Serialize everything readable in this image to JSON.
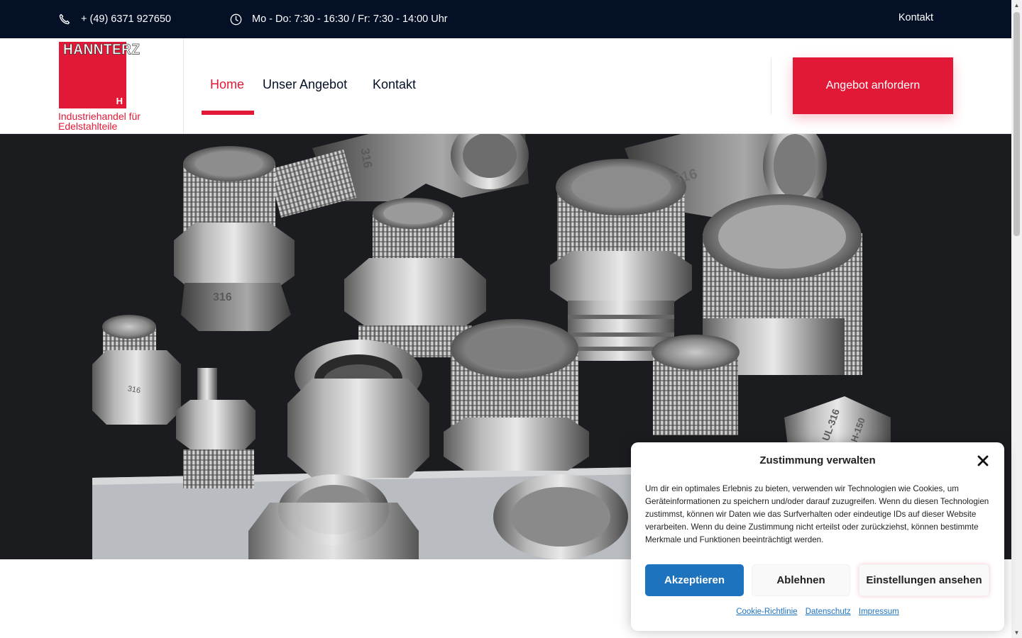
{
  "topbar": {
    "phone": "+ (49) 6371 927650",
    "hours": "Mo - Do: 7:30 - 16:30 / Fr: 7:30 - 14:00 Uhr",
    "contact_link": "Kontakt",
    "phone_icon": "phone-icon",
    "clock_icon": "clock-icon"
  },
  "header": {
    "logo_text": "HANNTERZ",
    "logo_mark": "H",
    "tagline": "Industriehandel für Edelstahlteile",
    "nav": [
      {
        "label": "Home",
        "active": true
      },
      {
        "label": "Unser Angebot",
        "active": false
      },
      {
        "label": "Kontakt",
        "active": false
      }
    ],
    "cta_label": "Angebot anfordern"
  },
  "hero": {
    "stamp_a": "316",
    "stamp_b": "316",
    "stamp_c": "316",
    "stamp_d": "H-150",
    "stamp_e": "316",
    "stamp_f": "UL-316"
  },
  "cookie": {
    "title": "Zustimmung verwalten",
    "text": "Um dir ein optimales Erlebnis zu bieten, verwenden wir Technologien wie Cookies, um Geräteinformationen zu speichern und/oder darauf zuzugreifen. Wenn du diesen Technologien zustimmst, können wir Daten wie das Surfverhalten oder eindeutige IDs auf dieser Website verarbeiten. Wenn du deine Zustimmung nicht erteilst oder zurückziehst, können bestimmte Merkmale und Funktionen beeinträchtigt werden.",
    "accept": "Akzeptieren",
    "deny": "Ablehnen",
    "prefs": "Einstellungen ansehen",
    "links": [
      "Cookie-Richtlinie",
      "Datenschutz",
      "Impressum"
    ]
  },
  "colors": {
    "topbar_bg": "#041026",
    "brand_red": "#e21936",
    "accept_blue": "#1e73be"
  }
}
